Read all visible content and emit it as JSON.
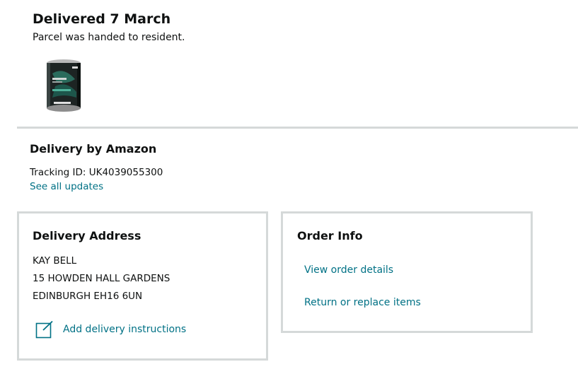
{
  "status": {
    "title": "Delivered 7 March",
    "subtitle": "Parcel was handed to resident."
  },
  "product": {
    "image_icon": "purina-proplan-can-image"
  },
  "carrier": {
    "title": "Delivery by Amazon",
    "tracking_text": "Tracking ID: UK4039055300",
    "see_updates_label": "See all updates"
  },
  "address_box": {
    "title": "Delivery Address",
    "name": "KAY BELL",
    "street": "15 HOWDEN HALL GARDENS",
    "city": "EDINBURGH EH16 6UN",
    "instructions_label": "Add delivery instructions",
    "instructions_icon": "edit-note-icon"
  },
  "order_box": {
    "title": "Order Info",
    "view_details_label": "View order details",
    "return_label": "Return or replace items"
  },
  "colors": {
    "link": "#007185",
    "text": "#0f1111",
    "border": "#d5d9d9"
  }
}
